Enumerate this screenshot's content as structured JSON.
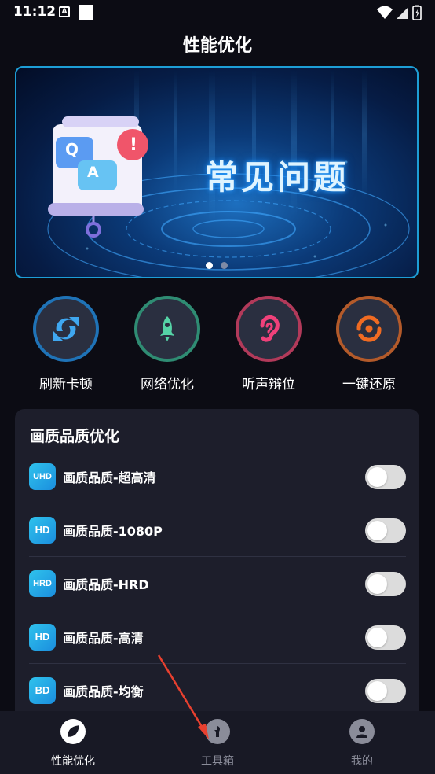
{
  "status_bar": {
    "time": "11:12",
    "a_icon_text": "A"
  },
  "page": {
    "title": "性能优化"
  },
  "banner": {
    "title": "常见问题",
    "q_letter": "Q",
    "a_letter": "A",
    "alert_mark": "!",
    "active_slide": 1,
    "slide_count": 2
  },
  "quick_actions": [
    {
      "label": "刷新卡顿",
      "icon": "refresh-icon",
      "color": "#1f73b7"
    },
    {
      "label": "网络优化",
      "icon": "rocket-icon",
      "color": "#2f8c73"
    },
    {
      "label": "听声辩位",
      "icon": "ear-icon",
      "color": "#b23a5a"
    },
    {
      "label": "一键还原",
      "icon": "restore-icon",
      "color": "#b35a2a"
    }
  ],
  "quality": {
    "title": "画质品质优化",
    "items": [
      {
        "badge": "UHD",
        "label": "画质品质-超高清",
        "enabled": false
      },
      {
        "badge": "HD",
        "label": "画质品质-1080P",
        "enabled": false
      },
      {
        "badge": "HRD",
        "label": "画质品质-HRD",
        "enabled": false
      },
      {
        "badge": "HD",
        "label": "画质品质-高清",
        "enabled": false
      },
      {
        "badge": "BD",
        "label": "画质品质-均衡",
        "enabled": false
      }
    ]
  },
  "bottom_nav": [
    {
      "label": "性能优化",
      "icon": "leaf-icon",
      "active": true
    },
    {
      "label": "工具箱",
      "icon": "wrench-icon",
      "active": false
    },
    {
      "label": "我的",
      "icon": "user-icon",
      "active": false
    }
  ],
  "colors": {
    "accent_blue": "#1d9ed6",
    "background": "#0c0c14",
    "card": "#1d1e2b",
    "annotation_arrow": "#e8402f"
  }
}
